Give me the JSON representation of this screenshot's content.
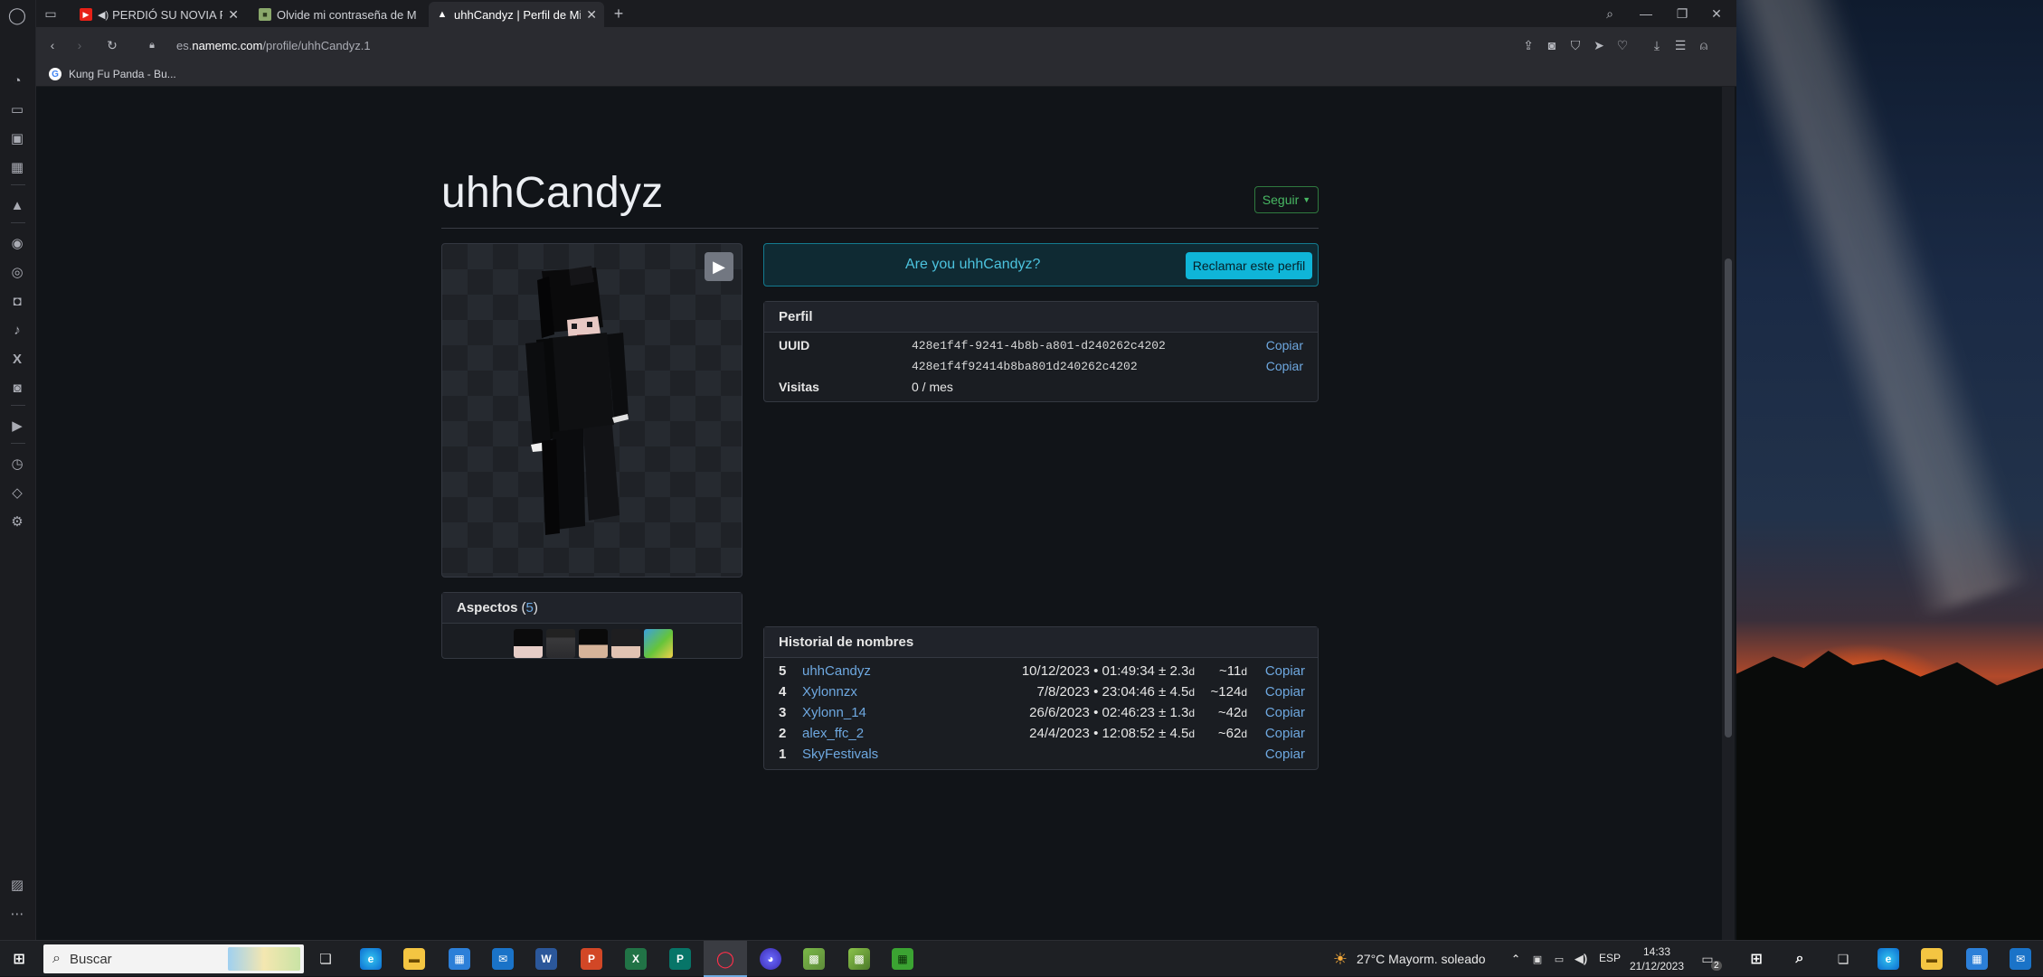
{
  "tabs": [
    {
      "label": "PERDIÓ SU NOVIA POR",
      "favicon": "youtube-icon"
    },
    {
      "label": "Olvide mi contraseña de M",
      "favicon": "minecraft-icon"
    },
    {
      "label": "uhhCandyz | Perfil de Mine",
      "favicon": "namemc-icon"
    }
  ],
  "address": {
    "prefix": "es.",
    "domain": "namemc.com",
    "path": "/profile/uhhCandyz.1"
  },
  "bookmarks": [
    {
      "label": "Kung Fu Panda - Bu..."
    }
  ],
  "profile": {
    "username": "uhhCandyz",
    "follow_label": "Seguir",
    "claim_text": "Are you uhhCandyz?",
    "claim_button": "Reclamar este perfil",
    "skins_label": "Aspectos",
    "skins_count": "5",
    "info_title": "Perfil",
    "uuid_label": "UUID",
    "uuid_dashed": "428e1f4f-9241-4b8b-a801-d240262c4202",
    "uuid_plain": "428e1f4f92414b8ba801d240262c4202",
    "copy_label": "Copiar",
    "views_label": "Visitas",
    "views_value": "0 / mes"
  },
  "name_history": {
    "title": "Historial de nombres",
    "rows": [
      {
        "num": "5",
        "name": "uhhCandyz",
        "date": "10/12/2023 • 01:49:34 ± 2.3",
        "unit": "d",
        "dur": "~11",
        "copy": "Copiar"
      },
      {
        "num": "4",
        "name": "Xylonnzx",
        "date": "7/8/2023 • 23:04:46 ± 4.5",
        "unit": "d",
        "dur": "~124",
        "copy": "Copiar"
      },
      {
        "num": "3",
        "name": "Xylonn_14",
        "date": "26/6/2023 • 02:46:23 ± 1.3",
        "unit": "d",
        "dur": "~42",
        "copy": "Copiar"
      },
      {
        "num": "2",
        "name": "alex_ffc_2",
        "date": "24/4/2023 • 12:08:52 ± 4.5",
        "unit": "d",
        "dur": "~62",
        "copy": "Copiar"
      },
      {
        "num": "1",
        "name": "SkyFestivals",
        "date": "",
        "unit": "",
        "dur": "",
        "copy": "Copiar"
      }
    ]
  },
  "taskbar": {
    "search_placeholder": "Buscar",
    "weather": "27°C  Mayorm. soleado",
    "lang": "ESP",
    "time": "14:33",
    "date": "21/12/2023",
    "notif_count": "2"
  },
  "colors": {
    "accent": "#0fb5d8",
    "link": "#6ea8e0",
    "follow": "#48b863"
  }
}
